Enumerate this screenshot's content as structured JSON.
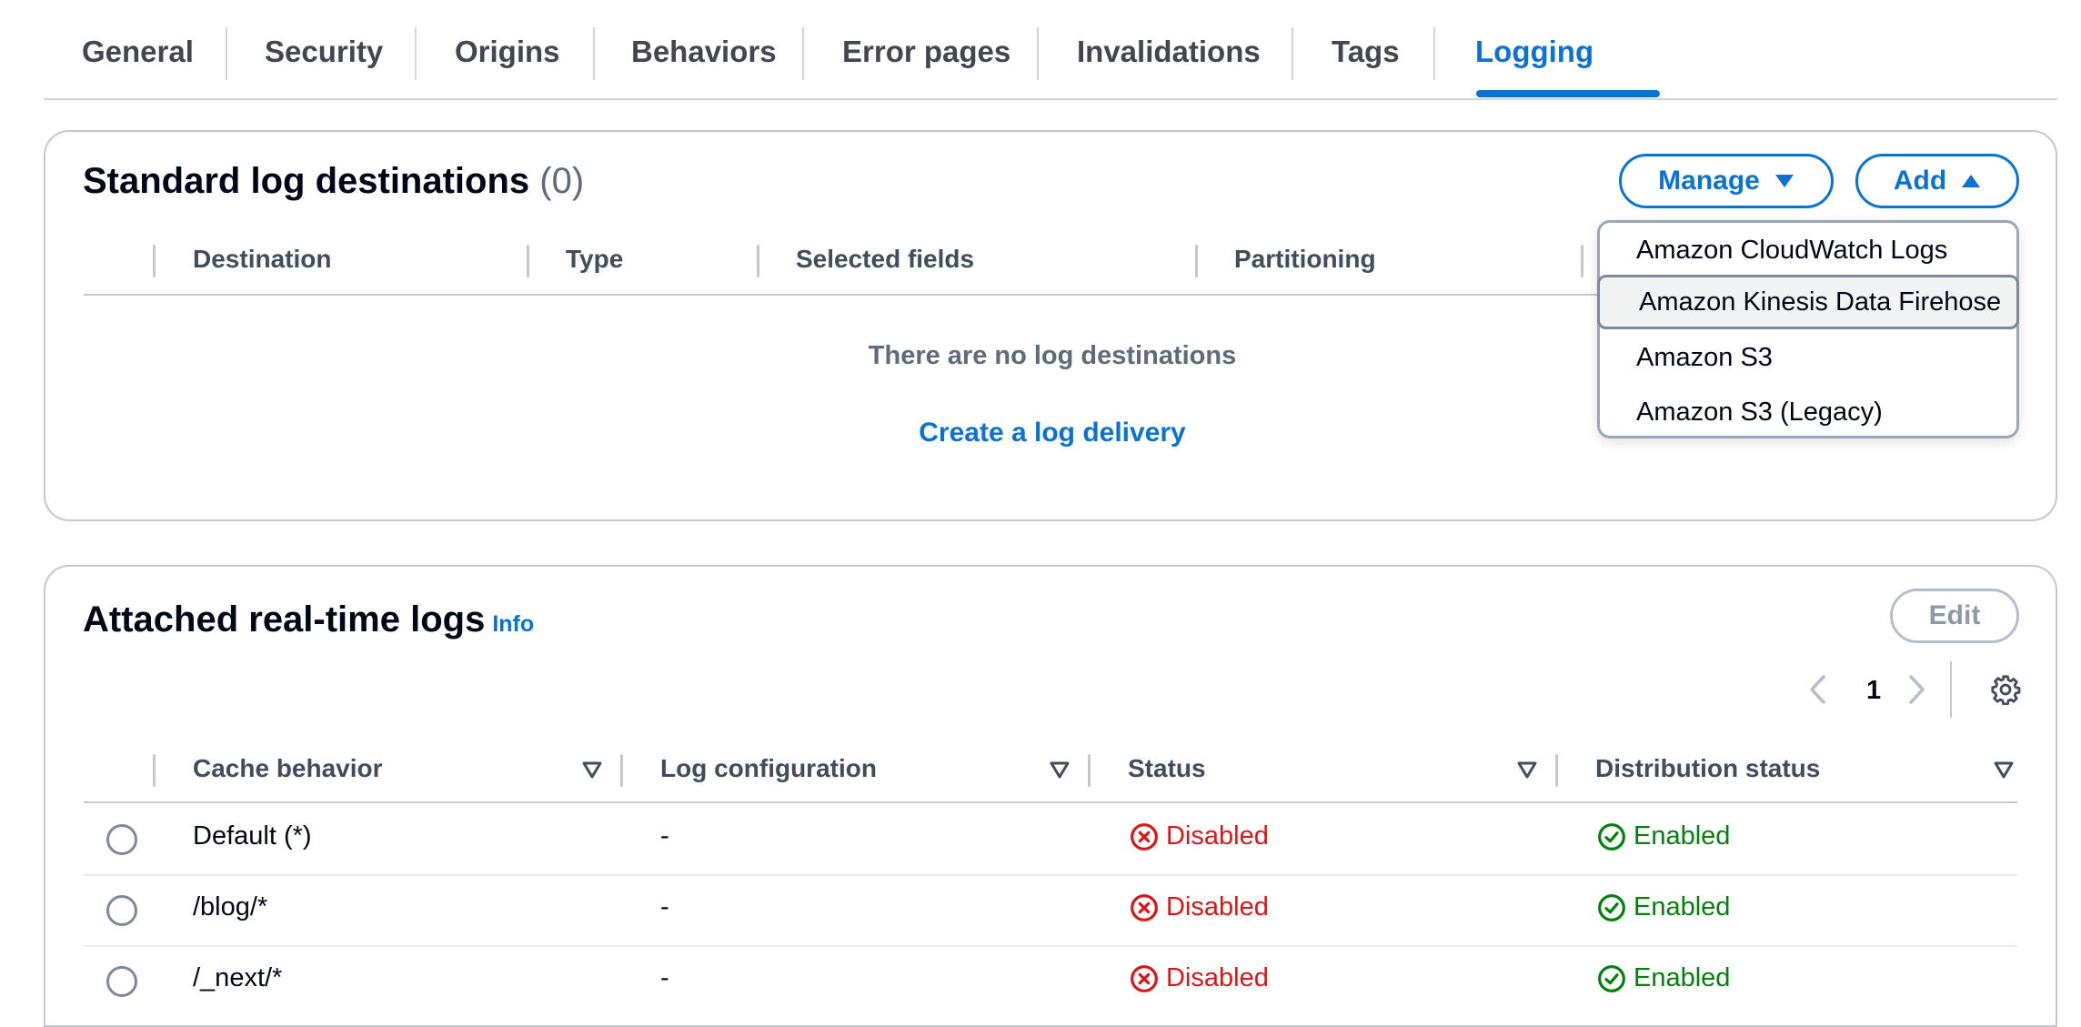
{
  "tabs": [
    {
      "label": "General"
    },
    {
      "label": "Security"
    },
    {
      "label": "Origins"
    },
    {
      "label": "Behaviors"
    },
    {
      "label": "Error pages"
    },
    {
      "label": "Invalidations"
    },
    {
      "label": "Tags"
    },
    {
      "label": "Logging",
      "active": true
    }
  ],
  "standard": {
    "title": "Standard log destinations",
    "count": "(0)",
    "manage_label": "Manage",
    "add_label": "Add",
    "columns": [
      "Destination",
      "Type",
      "Selected fields",
      "Partitioning"
    ],
    "empty_message": "There are no log destinations",
    "create_link": "Create a log delivery"
  },
  "add_menu": {
    "items": [
      "Amazon CloudWatch Logs",
      "Amazon Kinesis Data Firehose",
      "Amazon S3",
      "Amazon S3 (Legacy)"
    ],
    "highlighted_index": 1
  },
  "realtime": {
    "title": "Attached real-time logs",
    "info_label": "Info",
    "edit_label": "Edit",
    "page": "1",
    "columns": [
      "Cache behavior",
      "Log configuration",
      "Status",
      "Distribution status"
    ],
    "rows": [
      {
        "behavior": "Default (*)",
        "config": "-",
        "status": "Disabled",
        "dist_status": "Enabled"
      },
      {
        "behavior": "/blog/*",
        "config": "-",
        "status": "Disabled",
        "dist_status": "Enabled"
      },
      {
        "behavior": "/_next/*",
        "config": "-",
        "status": "Disabled",
        "dist_status": "Enabled"
      }
    ]
  },
  "colors": {
    "accent": "#0972d3",
    "error": "#d91515",
    "success": "#037f0c"
  }
}
